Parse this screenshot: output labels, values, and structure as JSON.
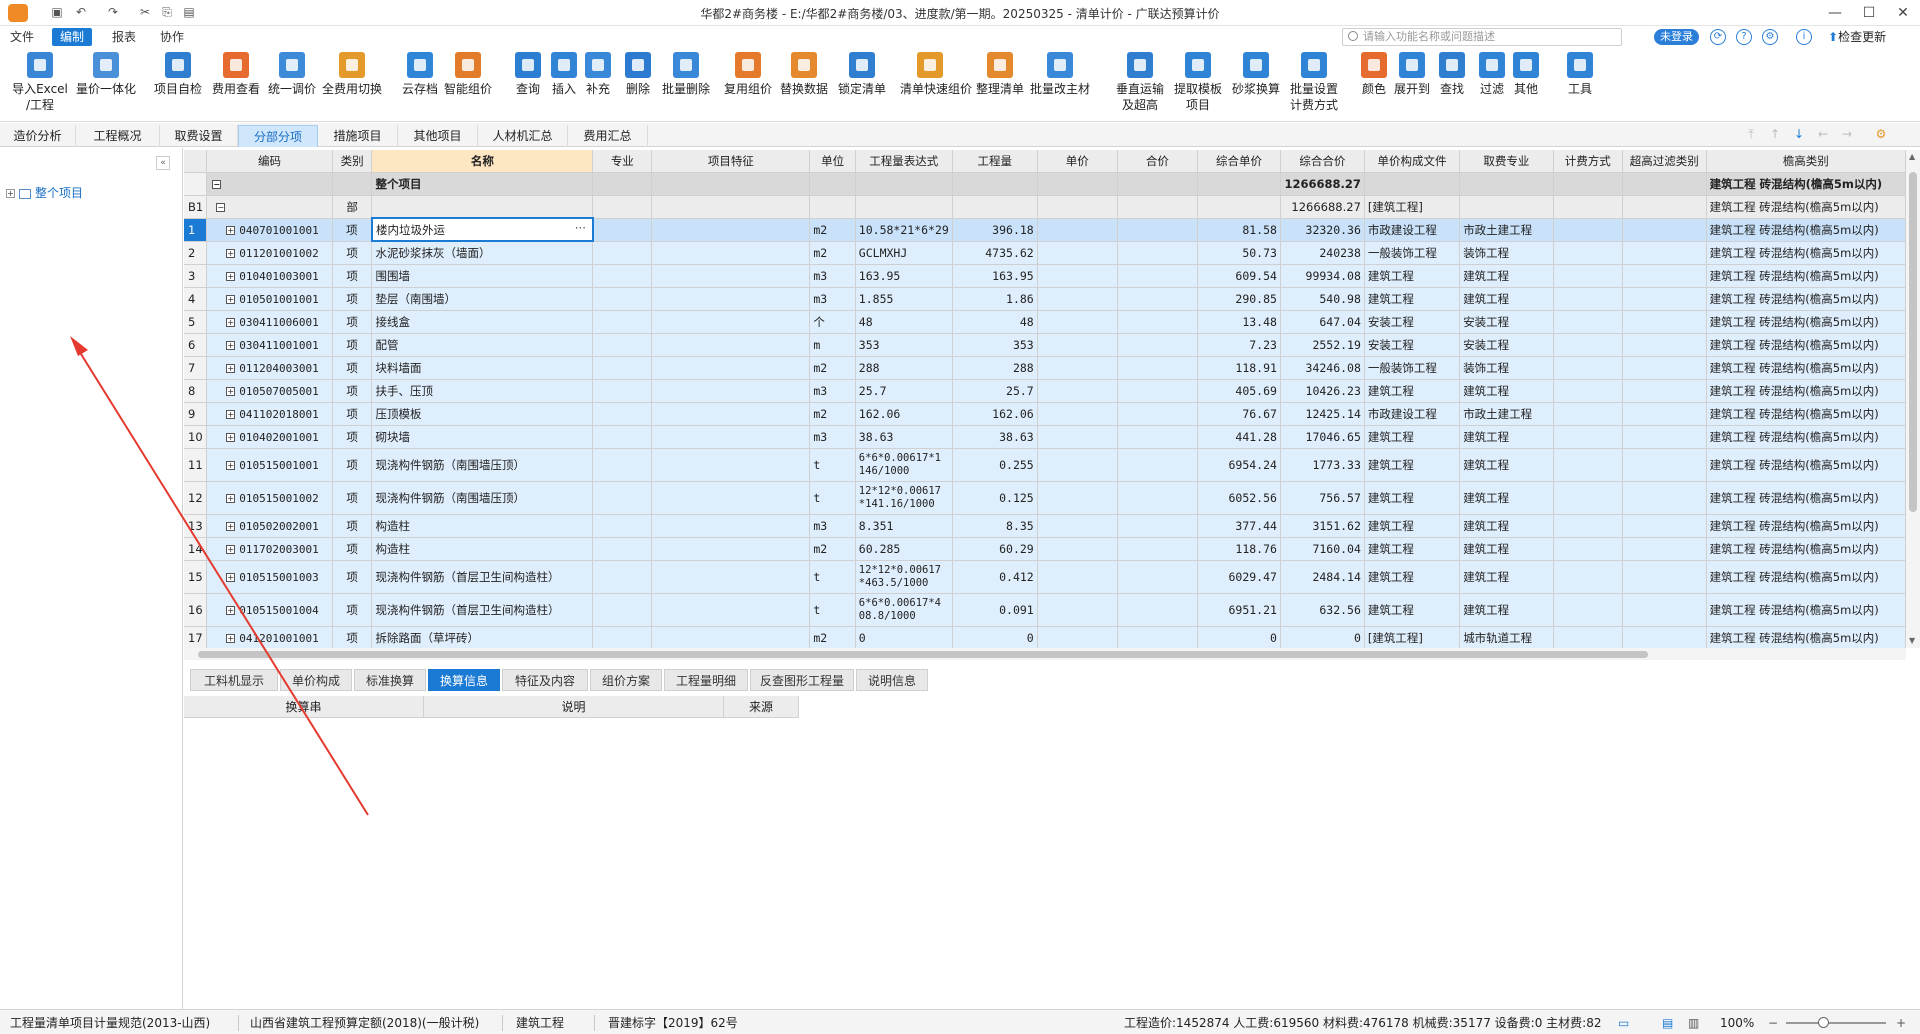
{
  "titlebar": {
    "title": "华都2#商务楼 - E:/华都2#商务楼/03、进度款/第一期。20250325 - 清单计价 - 广联达预算计价"
  },
  "menu": {
    "items": [
      "文件",
      "编制",
      "报表",
      "协作"
    ],
    "active": "编制",
    "search_placeholder": "请输入功能名称或问题描述",
    "login": "未登录",
    "update": "检查更新"
  },
  "ribbon": {
    "buttons": [
      {
        "label": "导入Excel",
        "label2": "/工程",
        "color": "#3a86d6"
      },
      {
        "label": "量价一体化",
        "label2": "",
        "color": "#4a90d9"
      },
      {
        "label": "项目自检",
        "label2": "",
        "color": "#2f7ed0"
      },
      {
        "label": "费用查看",
        "label2": "",
        "color": "#e56b2e"
      },
      {
        "label": "统一调价",
        "label2": "",
        "color": "#3d8ad8"
      },
      {
        "label": "全费用切换",
        "label2": "",
        "color": "#e39a2b"
      },
      {
        "label": "云存档",
        "label2": "",
        "color": "#2f86d6"
      },
      {
        "label": "智能组价",
        "label2": "",
        "color": "#e27b2a"
      },
      {
        "label": "查询",
        "label2": "",
        "color": "#2b7ed2"
      },
      {
        "label": "插入",
        "label2": "",
        "color": "#2f84d6"
      },
      {
        "label": "补充",
        "label2": "",
        "color": "#3a88d8"
      },
      {
        "label": "删除",
        "label2": "",
        "color": "#2d7bd0"
      },
      {
        "label": "批量删除",
        "label2": "",
        "color": "#3a88d8"
      },
      {
        "label": "复用组价",
        "label2": "",
        "color": "#e57a2c"
      },
      {
        "label": "替换数据",
        "label2": "",
        "color": "#e5892e"
      },
      {
        "label": "锁定清单",
        "label2": "",
        "color": "#2f7ed0"
      },
      {
        "label": "清单快速组价",
        "label2": "",
        "color": "#e39a2b"
      },
      {
        "label": "整理清单",
        "label2": "",
        "color": "#e5892e"
      },
      {
        "label": "批量改主材",
        "label2": "",
        "color": "#3a88d8"
      },
      {
        "label": "垂直运输",
        "label2": "及超高",
        "color": "#2f7ed0"
      },
      {
        "label": "提取模板",
        "label2": "项目",
        "color": "#2f84d6"
      },
      {
        "label": "砂浆换算",
        "label2": "",
        "color": "#2f84d6"
      },
      {
        "label": "批量设置",
        "label2": "计费方式",
        "color": "#2f84d6"
      },
      {
        "label": "颜色",
        "label2": "",
        "color": "#e56b2e"
      },
      {
        "label": "展开到",
        "label2": "",
        "color": "#2f84d6"
      },
      {
        "label": "查找",
        "label2": "",
        "color": "#2f7ed0"
      },
      {
        "label": "过滤",
        "label2": "",
        "color": "#2f84d6"
      },
      {
        "label": "其他",
        "label2": "",
        "color": "#2f84d6"
      },
      {
        "label": "工具",
        "label2": "",
        "color": "#2f84d6"
      }
    ]
  },
  "tabs": {
    "items": [
      "造价分析",
      "工程概况",
      "取费设置",
      "分部分项",
      "措施项目",
      "其他项目",
      "人材机汇总",
      "费用汇总"
    ],
    "active": "分部分项"
  },
  "left": {
    "tree_root": "整个项目"
  },
  "grid": {
    "columns": [
      "",
      "编码",
      "类别",
      "名称",
      "专业",
      "项目特征",
      "单位",
      "工程量表达式",
      "工程量",
      "单价",
      "合价",
      "综合单价",
      "综合合价",
      "单价构成文件",
      "取费专业",
      "计费方式",
      "超高过滤类别",
      "檐高类别"
    ],
    "whole_row": {
      "name": "整个项目",
      "total": "1266688.27",
      "eaves": "建筑工程  砖混结构(檐高5m以内)"
    },
    "part_row": {
      "idx": "B1",
      "type": "部",
      "total": "1266688.27",
      "file": "[建筑工程]",
      "eaves": "建筑工程  砖混结构(檐高5m以内)"
    },
    "rows": [
      {
        "idx": "1",
        "code": "040701001001",
        "type": "项",
        "name": "楼内垃圾外运",
        "unit": "m2",
        "expr": "10.58*21*6*29",
        "qty": "396.18",
        "uprice": "81.58",
        "total": "32320.36",
        "file": "市政建设工程",
        "fee": "市政土建工程",
        "eaves": "建筑工程  砖混结构(檐高5m以内)"
      },
      {
        "idx": "2",
        "code": "011201001002",
        "type": "项",
        "name": "水泥砂浆抹灰（墙面）",
        "unit": "m2",
        "expr": "GCLMXHJ",
        "qty": "4735.62",
        "uprice": "50.73",
        "total": "240238",
        "file": "一般装饰工程",
        "fee": "装饰工程",
        "eaves": "建筑工程  砖混结构(檐高5m以内)"
      },
      {
        "idx": "3",
        "code": "010401003001",
        "type": "项",
        "name": "围围墙",
        "unit": "m3",
        "expr": "163.95",
        "qty": "163.95",
        "uprice": "609.54",
        "total": "99934.08",
        "file": "建筑工程",
        "fee": "建筑工程",
        "eaves": "建筑工程  砖混结构(檐高5m以内)"
      },
      {
        "idx": "4",
        "code": "010501001001",
        "type": "项",
        "name": "垫层（南围墙）",
        "unit": "m3",
        "expr": "1.855",
        "qty": "1.86",
        "uprice": "290.85",
        "total": "540.98",
        "file": "建筑工程",
        "fee": "建筑工程",
        "eaves": "建筑工程  砖混结构(檐高5m以内)"
      },
      {
        "idx": "5",
        "code": "030411006001",
        "type": "项",
        "name": "接线盒",
        "unit": "个",
        "expr": "48",
        "qty": "48",
        "uprice": "13.48",
        "total": "647.04",
        "file": "安装工程",
        "fee": "安装工程",
        "eaves": "建筑工程  砖混结构(檐高5m以内)"
      },
      {
        "idx": "6",
        "code": "030411001001",
        "type": "项",
        "name": "配管",
        "unit": "m",
        "expr": "353",
        "qty": "353",
        "uprice": "7.23",
        "total": "2552.19",
        "file": "安装工程",
        "fee": "安装工程",
        "eaves": "建筑工程  砖混结构(檐高5m以内)"
      },
      {
        "idx": "7",
        "code": "011204003001",
        "type": "项",
        "name": "块料墙面",
        "unit": "m2",
        "expr": "288",
        "qty": "288",
        "uprice": "118.91",
        "total": "34246.08",
        "file": "一般装饰工程",
        "fee": "装饰工程",
        "eaves": "建筑工程  砖混结构(檐高5m以内)"
      },
      {
        "idx": "8",
        "code": "010507005001",
        "type": "项",
        "name": "扶手、压顶",
        "unit": "m3",
        "expr": "25.7",
        "qty": "25.7",
        "uprice": "405.69",
        "total": "10426.23",
        "file": "建筑工程",
        "fee": "建筑工程",
        "eaves": "建筑工程  砖混结构(檐高5m以内)"
      },
      {
        "idx": "9",
        "code": "041102018001",
        "type": "项",
        "name": "压顶模板",
        "unit": "m2",
        "expr": "162.06",
        "qty": "162.06",
        "uprice": "76.67",
        "total": "12425.14",
        "file": "市政建设工程",
        "fee": "市政土建工程",
        "eaves": "建筑工程  砖混结构(檐高5m以内)"
      },
      {
        "idx": "10",
        "code": "010402001001",
        "type": "项",
        "name": "砌块墙",
        "unit": "m3",
        "expr": "38.63",
        "qty": "38.63",
        "uprice": "441.28",
        "total": "17046.65",
        "file": "建筑工程",
        "fee": "建筑工程",
        "eaves": "建筑工程  砖混结构(檐高5m以内)"
      },
      {
        "idx": "11",
        "code": "010515001001",
        "type": "项",
        "name": "现浇构件钢筋（南围墙压顶）",
        "unit": "t",
        "expr": "6*6*0.00617*1",
        "expr2": "146/1000",
        "qty": "0.255",
        "uprice": "6954.24",
        "total": "1773.33",
        "file": "建筑工程",
        "fee": "建筑工程",
        "eaves": "建筑工程  砖混结构(檐高5m以内)",
        "tall": true
      },
      {
        "idx": "12",
        "code": "010515001002",
        "type": "项",
        "name": "现浇构件钢筋（南围墙压顶）",
        "unit": "t",
        "expr": "12*12*0.00617",
        "expr2": "*141.16/1000",
        "qty": "0.125",
        "uprice": "6052.56",
        "total": "756.57",
        "file": "建筑工程",
        "fee": "建筑工程",
        "eaves": "建筑工程  砖混结构(檐高5m以内)",
        "tall": true
      },
      {
        "idx": "13",
        "code": "010502002001",
        "type": "项",
        "name": "构造柱",
        "unit": "m3",
        "expr": "8.351",
        "qty": "8.35",
        "uprice": "377.44",
        "total": "3151.62",
        "file": "建筑工程",
        "fee": "建筑工程",
        "eaves": "建筑工程  砖混结构(檐高5m以内)"
      },
      {
        "idx": "14",
        "code": "011702003001",
        "type": "项",
        "name": "构造柱",
        "unit": "m2",
        "expr": "60.285",
        "qty": "60.29",
        "uprice": "118.76",
        "total": "7160.04",
        "file": "建筑工程",
        "fee": "建筑工程",
        "eaves": "建筑工程  砖混结构(檐高5m以内)"
      },
      {
        "idx": "15",
        "code": "010515001003",
        "type": "项",
        "name": "现浇构件钢筋（首层卫生间构造柱）",
        "unit": "t",
        "expr": "12*12*0.00617",
        "expr2": "*463.5/1000",
        "qty": "0.412",
        "uprice": "6029.47",
        "total": "2484.14",
        "file": "建筑工程",
        "fee": "建筑工程",
        "eaves": "建筑工程  砖混结构(檐高5m以内)",
        "tall": true
      },
      {
        "idx": "16",
        "code": "010515001004",
        "type": "项",
        "name": "现浇构件钢筋（首层卫生间构造柱）",
        "unit": "t",
        "expr": "6*6*0.00617*4",
        "expr2": "08.8/1000",
        "qty": "0.091",
        "uprice": "6951.21",
        "total": "632.56",
        "file": "建筑工程",
        "fee": "建筑工程",
        "eaves": "建筑工程  砖混结构(檐高5m以内)",
        "tall": true
      },
      {
        "idx": "17",
        "code": "041201001001",
        "type": "项",
        "name": "拆除路面（草坪砖）",
        "unit": "m2",
        "expr": "0",
        "qty": "0",
        "uprice": "0",
        "total": "0",
        "file": "[建筑工程]",
        "fee": "城市轨道工程",
        "eaves": "建筑工程  砖混结构(檐高5m以内)"
      }
    ]
  },
  "bottom_tabs": {
    "items": [
      "工料机显示",
      "单价构成",
      "标准换算",
      "换算信息",
      "特征及内容",
      "组价方案",
      "工程量明细",
      "反查图形工程量",
      "说明信息"
    ],
    "active": "换算信息"
  },
  "bottom_grid": {
    "columns": [
      "换算串",
      "说明",
      "来源"
    ]
  },
  "status": {
    "spec": "工程量清单项目计量规范(2013-山西)",
    "quota": "山西省建筑工程预算定额(2018)(一般计税)",
    "discipline": "建筑工程",
    "doc": "晋建标字【2019】62号",
    "summary": "工程造价:1452874  人工费:619560  材料费:476178  机械费:35177  设备费:0  主材费:82",
    "zoom": "100%"
  },
  "accent": "#1a7ad4",
  "annotation_color": "#e53a2f"
}
